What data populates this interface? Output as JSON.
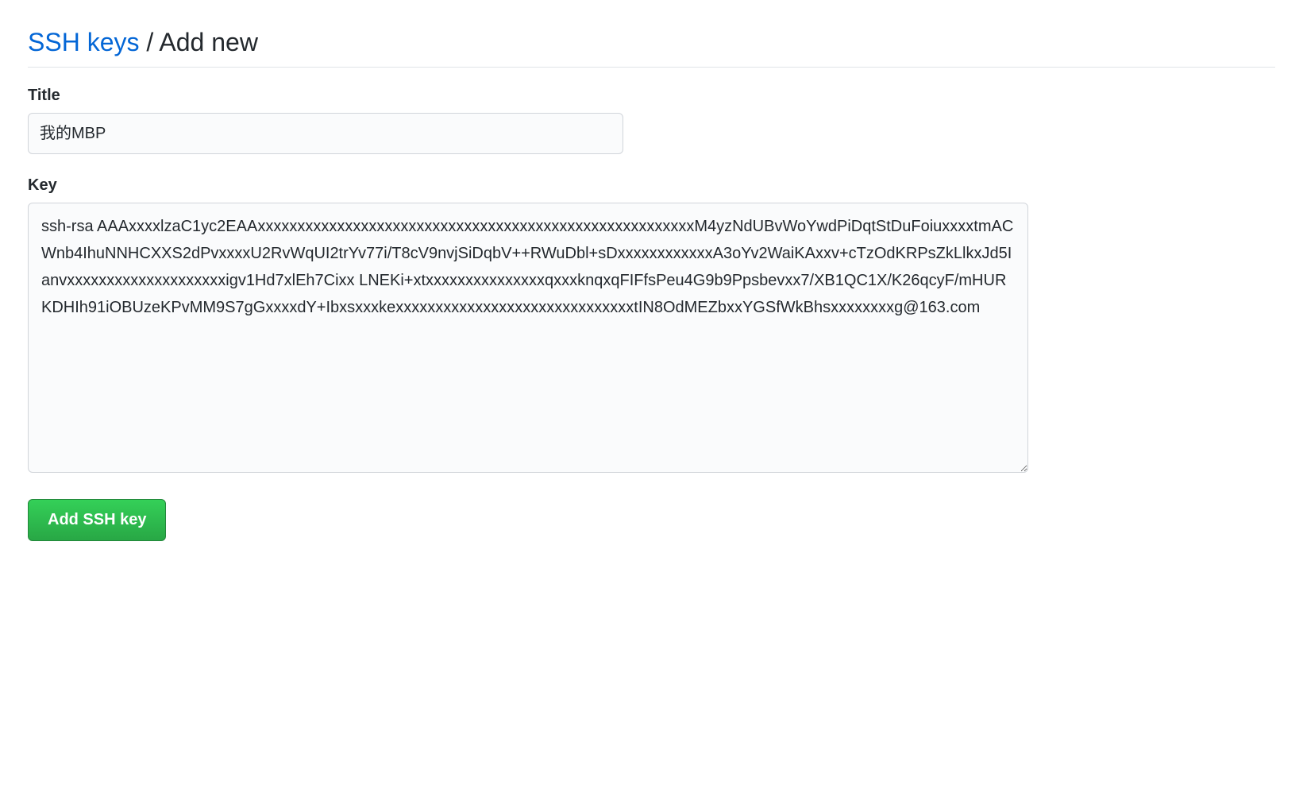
{
  "breadcrumb": {
    "link_label": "SSH keys",
    "separator": " / ",
    "current": "Add new"
  },
  "form": {
    "title_label": "Title",
    "title_value": "我的MBP",
    "key_label": "Key",
    "key_value": "ssh-rsa AAAxxxxlzaC1yc2EAAxxxxxxxxxxxxxxxxxxxxxxxxxxxxxxxxxxxxxxxxxxxxxxxxxxxxxxxM4yzNdUBvWoYwdPiDqtStDuFoiuxxxxtmACWnb4IhuNNHCXXS2dPvxxxxU2RvWqUI2trYv77i/T8cV9nvjSiDqbV++RWuDbl+sDxxxxxxxxxxxxA3oYv2WaiKAxxv+cTzOdKRPsZkLlkxJd5Ianvxxxxxxxxxxxxxxxxxxxxigv1Hd7xlEh7Cixx LNEKi+xtxxxxxxxxxxxxxxxqxxxknqxqFIFfsPeu4G9b9Ppsbevxx7/XB1QC1X/K26qcyF/mHURKDHIh91iOBUzeKPvMM9S7gGxxxxdY+IbxsxxxkexxxxxxxxxxxxxxxxxxxxxxxxxxxxxxtIN8OdMEZbxxYGSfWkBhsxxxxxxxxg@163.com",
    "submit_label": "Add SSH key"
  }
}
